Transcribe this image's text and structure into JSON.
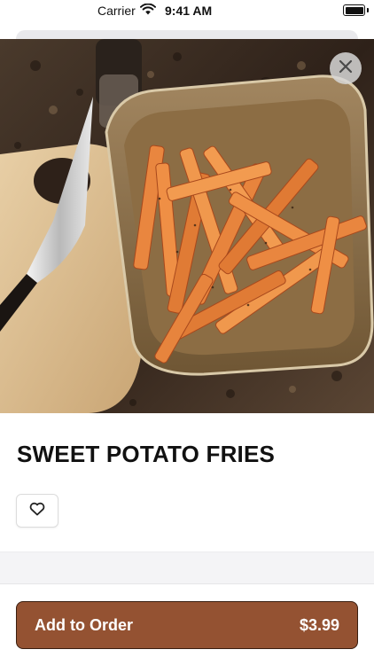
{
  "status_bar": {
    "carrier": "Carrier",
    "time": "9:41 AM",
    "wifi_icon": "wifi-icon",
    "battery_icon": "battery-icon"
  },
  "hero": {
    "image_icon": "food-photo",
    "close_icon": "close-icon"
  },
  "product": {
    "title": "SWEET POTATO FRIES",
    "favorite_icon": "heart-icon"
  },
  "order": {
    "button_label": "Add to Order",
    "price": "$3.99",
    "button_color": "#945232"
  }
}
